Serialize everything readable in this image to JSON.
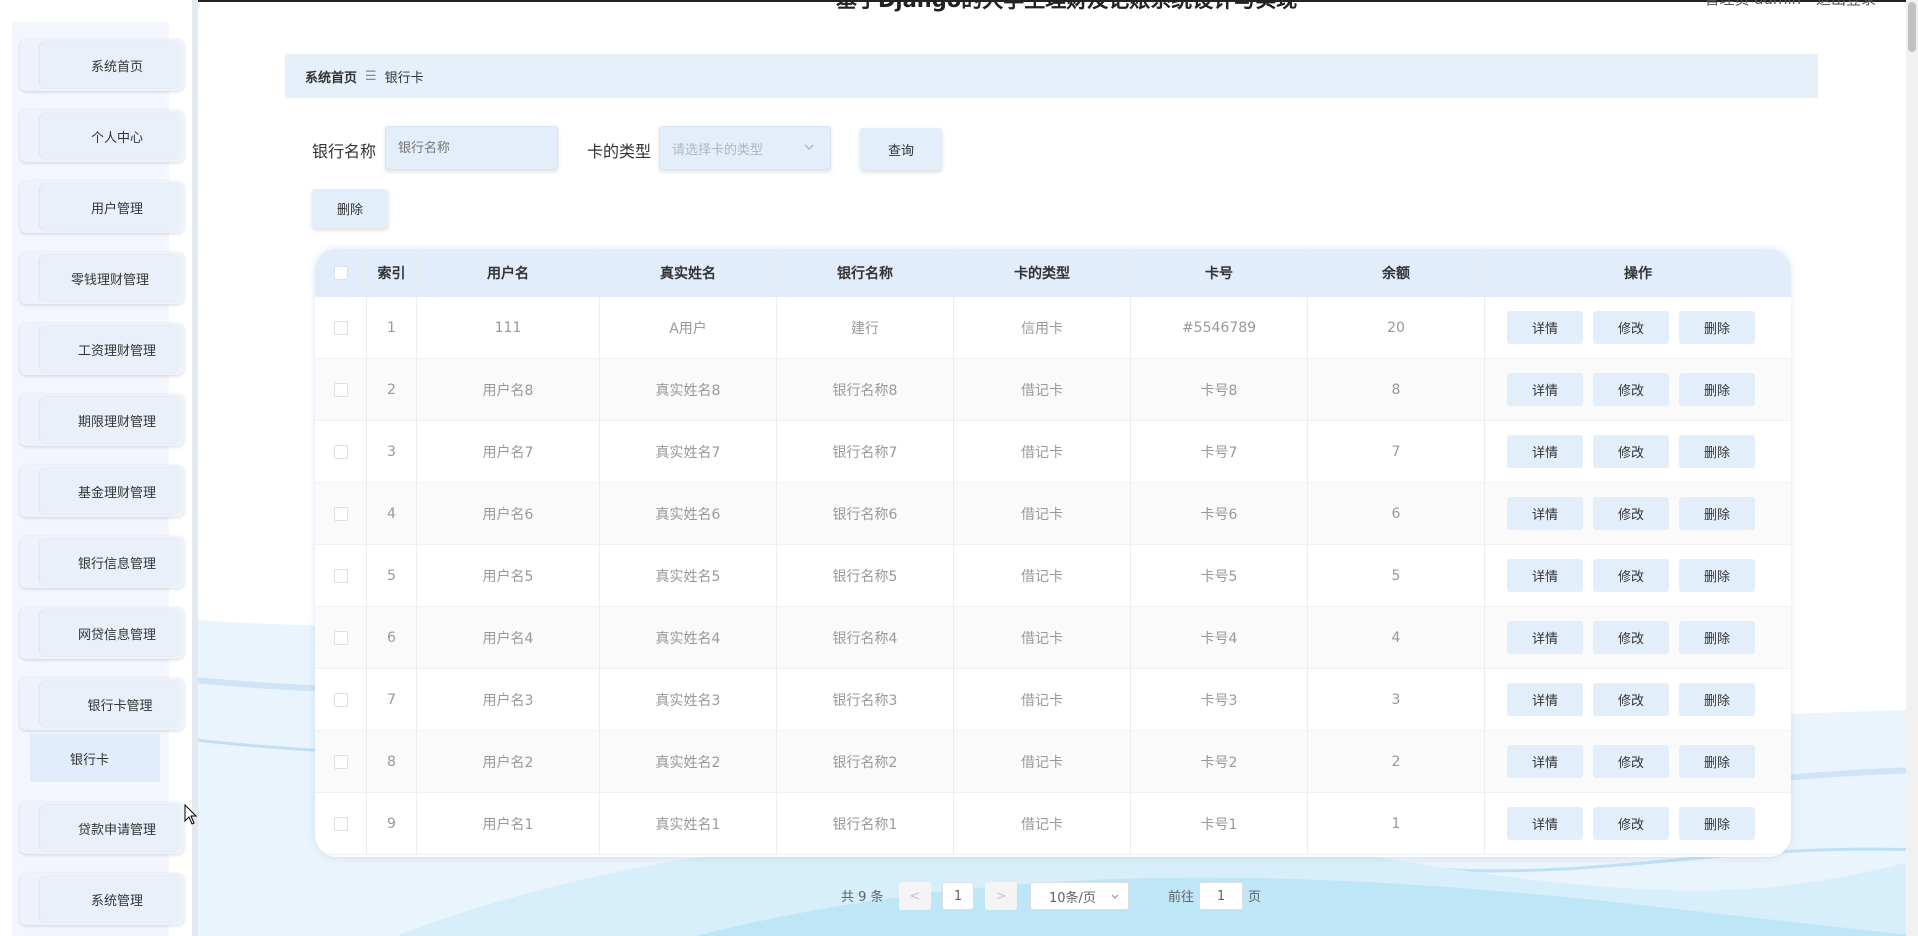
{
  "header": {
    "title": "基于Django的大学生理财及记账系统设计与实现",
    "user_info": "管理员 admin",
    "logout": "退出登录"
  },
  "sidebar": {
    "items": [
      {
        "label": "系统首页"
      },
      {
        "label": "个人中心"
      },
      {
        "label": "用户管理"
      },
      {
        "label": "零钱理财管理"
      },
      {
        "label": "工资理财管理"
      },
      {
        "label": "期限理财管理"
      },
      {
        "label": "基金理财管理"
      },
      {
        "label": "银行信息管理"
      },
      {
        "label": "网贷信息管理"
      },
      {
        "label": "银行卡管理"
      },
      {
        "label": "贷款申请管理"
      },
      {
        "label": "系统管理"
      }
    ],
    "submenu": {
      "label": "银行卡"
    }
  },
  "breadcrumb": {
    "home": "系统首页",
    "separator": "☰",
    "current": "银行卡"
  },
  "search": {
    "bank_name_label": "银行名称",
    "bank_name_placeholder": "银行名称",
    "card_type_label": "卡的类型",
    "card_type_placeholder": "请选择卡的类型",
    "query_button": "查询"
  },
  "actions": {
    "delete_button": "删除"
  },
  "table": {
    "columns": [
      "索引",
      "用户名",
      "真实姓名",
      "银行名称",
      "卡的类型",
      "卡号",
      "余额",
      "操作"
    ],
    "rows": [
      {
        "index": "1",
        "username": "111",
        "realname": "A用户",
        "bank": "建行",
        "type": "信用卡",
        "card": "#5546789",
        "balance": "20"
      },
      {
        "index": "2",
        "username": "用户名8",
        "realname": "真实姓名8",
        "bank": "银行名称8",
        "type": "借记卡",
        "card": "卡号8",
        "balance": "8"
      },
      {
        "index": "3",
        "username": "用户名7",
        "realname": "真实姓名7",
        "bank": "银行名称7",
        "type": "借记卡",
        "card": "卡号7",
        "balance": "7"
      },
      {
        "index": "4",
        "username": "用户名6",
        "realname": "真实姓名6",
        "bank": "银行名称6",
        "type": "借记卡",
        "card": "卡号6",
        "balance": "6"
      },
      {
        "index": "5",
        "username": "用户名5",
        "realname": "真实姓名5",
        "bank": "银行名称5",
        "type": "借记卡",
        "card": "卡号5",
        "balance": "5"
      },
      {
        "index": "6",
        "username": "用户名4",
        "realname": "真实姓名4",
        "bank": "银行名称4",
        "type": "借记卡",
        "card": "卡号4",
        "balance": "4"
      },
      {
        "index": "7",
        "username": "用户名3",
        "realname": "真实姓名3",
        "bank": "银行名称3",
        "type": "借记卡",
        "card": "卡号3",
        "balance": "3"
      },
      {
        "index": "8",
        "username": "用户名2",
        "realname": "真实姓名2",
        "bank": "银行名称2",
        "type": "借记卡",
        "card": "卡号2",
        "balance": "2"
      },
      {
        "index": "9",
        "username": "用户名1",
        "realname": "真实姓名1",
        "bank": "银行名称1",
        "type": "借记卡",
        "card": "卡号1",
        "balance": "1"
      }
    ],
    "row_actions": {
      "detail": "详情",
      "edit": "修改",
      "delete": "删除"
    }
  },
  "pagination": {
    "total": "共 9 条",
    "prev": "<",
    "page": "1",
    "next": ">",
    "page_size": "10条/页",
    "goto_label": "前往",
    "goto_value": "1",
    "goto_suffix": "页"
  }
}
